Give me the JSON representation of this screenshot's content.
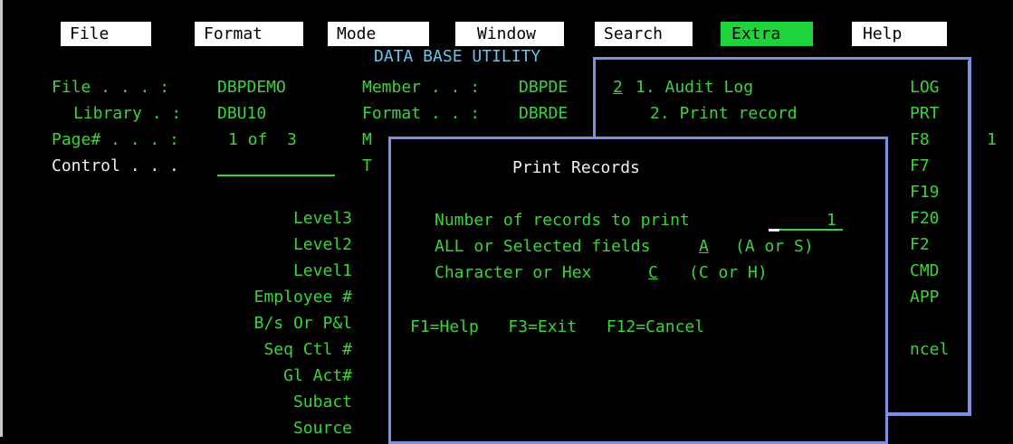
{
  "menu": {
    "file": "File",
    "format": "Format",
    "mode": "Mode",
    "window": "Window",
    "search": "Search",
    "extra": "Extra",
    "help": "Help"
  },
  "title": "DATA BASE UTILITY",
  "info": {
    "file_label": "File . . . :",
    "file_value": "DBPDEMO",
    "library_label": "Library . :",
    "library_value": "DBU10",
    "page_label": "Page# . . . :",
    "page_value": "1 of  3",
    "control_label": "Control . . .",
    "member_label": "Member . . :",
    "member_value": "DBPDE",
    "format_label": "Format . . :",
    "format_value": "DBRDE",
    "m_label": "M",
    "t_label": "T"
  },
  "fields": [
    "Level3",
    "Level2",
    "Level1",
    "Employee #",
    "B/s Or P&l",
    "Seq Ctl #",
    "Gl Act#",
    "Subact",
    "Source"
  ],
  "extra_menu": {
    "selection": "2",
    "item1": "1. Audit Log",
    "item2": "2. Print record",
    "keys": [
      "LOG",
      "PRT",
      "F8",
      "F7",
      "F19",
      "F20",
      "F2",
      "CMD",
      "APP",
      "",
      "ncel"
    ],
    "edge_char": "1"
  },
  "print_dialog": {
    "title": "Print Records",
    "records_label": "Number of records to print",
    "records_value": "1",
    "fields_label": "ALL or Selected fields",
    "fields_value": "A",
    "fields_hint": "(A or S)",
    "format_label": "Character or Hex",
    "format_value": "C",
    "format_hint": "(C or H)",
    "fkeys": "F1=Help   F3=Exit   F12=Cancel"
  }
}
